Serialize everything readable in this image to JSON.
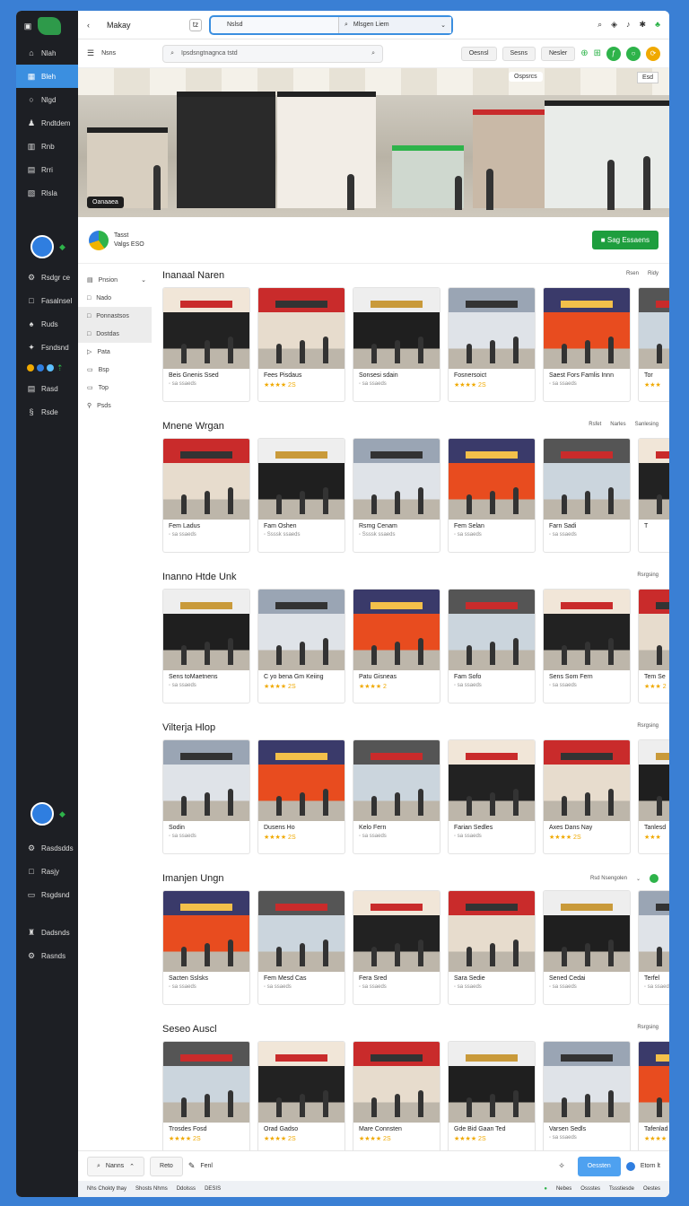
{
  "leftnav": {
    "items": [
      {
        "icon": "home-icon",
        "label": "Nlah"
      },
      {
        "icon": "grid-icon",
        "label": "Bleh"
      },
      {
        "icon": "circle-icon",
        "label": "Nlgd"
      },
      {
        "icon": "users-icon",
        "label": "Rndtdem"
      },
      {
        "icon": "chart-icon",
        "label": "Rnb"
      },
      {
        "icon": "doc-icon",
        "label": "Rrri"
      },
      {
        "icon": "file-icon",
        "label": "Rlsla"
      }
    ],
    "group2": [
      {
        "icon": "settings-icon",
        "label": "Rsdgr ce"
      },
      {
        "icon": "box-icon",
        "label": "Fasalnsel"
      },
      {
        "icon": "tag-icon",
        "label": "Ruds"
      },
      {
        "icon": "star-icon",
        "label": "Fsndsnd"
      }
    ],
    "group3": [
      {
        "icon": "doc-icon",
        "label": "Rasd"
      },
      {
        "icon": "sync-icon",
        "label": "Rsde"
      }
    ],
    "group4": [
      {
        "icon": "settings-icon",
        "label": "Rasdsdds"
      },
      {
        "icon": "box-icon",
        "label": "Rasjy"
      },
      {
        "icon": "card-icon",
        "label": "Rsgdsnd"
      }
    ],
    "group5": [
      {
        "icon": "tool-icon",
        "label": "Dadsnds"
      },
      {
        "icon": "settings-icon",
        "label": "Rasnds"
      }
    ]
  },
  "topbar": {
    "title": "Makay",
    "box_label": "tz",
    "url_left": "Nslsd",
    "url_right": "Mlsgen Liem"
  },
  "toolbar": {
    "menu_label": "Nsns",
    "search_placeholder": "Ipsdsngtnagnca tstd",
    "pills": [
      "Oesnsl",
      "Sesns",
      "Nesler"
    ]
  },
  "hero": {
    "badge_left": "Oanaaea",
    "badge_right": "Esd",
    "badge_top": "Ospsrcs"
  },
  "brand": {
    "line1": "Tasst",
    "line2": "Valgs ESO",
    "cta": "Sag Essaens"
  },
  "categories": [
    {
      "label": "Pnsion",
      "highlight": false
    },
    {
      "label": "Nado",
      "highlight": false
    },
    {
      "label": "Ponnastsos",
      "highlight": true
    },
    {
      "label": "Dostdas",
      "highlight": true
    },
    {
      "label": "Pata",
      "highlight": false
    },
    {
      "label": "Bsp",
      "highlight": false
    },
    {
      "label": "Top",
      "highlight": false
    },
    {
      "label": "Psds",
      "highlight": false
    }
  ],
  "sections": [
    {
      "title": "Inanaal Naren",
      "right": [
        "Rsen",
        "Ridy"
      ],
      "cards": [
        {
          "name": "Beis Gnenis Ssed",
          "sub": "◦ sa ssaeds",
          "stars": ""
        },
        {
          "name": "Fees Pisdaus",
          "sub": "",
          "stars": "★★★★ 2S"
        },
        {
          "name": "Sonsesi sdain",
          "sub": "◦ sa ssaeds",
          "stars": ""
        },
        {
          "name": "Fosnersoict",
          "sub": "",
          "stars": "★★★★ 2S"
        },
        {
          "name": "Saest Fors Famlis Innn",
          "sub": "◦ sa ssaeds",
          "stars": ""
        },
        {
          "name": "Tor",
          "sub": "",
          "stars": "★★★"
        }
      ]
    },
    {
      "title": "Mnene Wrgan",
      "right": [
        "Rsfet",
        "Narles",
        "Sanlesing"
      ],
      "cards": [
        {
          "name": "Fem Ladus",
          "sub": "◦ sa ssaeds",
          "stars": ""
        },
        {
          "name": "Fam Oshen",
          "sub": "◦ Ssssk ssaeds",
          "stars": ""
        },
        {
          "name": "Rsmg Cenam",
          "sub": "◦ Ssssk ssaeds",
          "stars": ""
        },
        {
          "name": "Fem Selan",
          "sub": "◦ sa ssaeds",
          "stars": ""
        },
        {
          "name": "Farn Sadi",
          "sub": "◦ sa ssaeds",
          "stars": ""
        },
        {
          "name": "T",
          "sub": "",
          "stars": ""
        }
      ]
    },
    {
      "title": "Inanno Htde Unk",
      "right": [
        "Rsrgsing"
      ],
      "cards": [
        {
          "name": "Sens toMaetnens",
          "sub": "◦ sa ssaeds",
          "stars": ""
        },
        {
          "name": "C yo bena Gm Keiing",
          "sub": "",
          "stars": "★★★★ 2S"
        },
        {
          "name": "Patu Gisneas",
          "sub": "",
          "stars": "★★★★ 2"
        },
        {
          "name": "Fam Sofo",
          "sub": "◦ sa ssaeds",
          "stars": ""
        },
        {
          "name": "Sens Som Fern",
          "sub": "◦ sa ssaeds",
          "stars": ""
        },
        {
          "name": "Tem Se",
          "sub": "",
          "stars": "★★★ 2"
        }
      ]
    },
    {
      "title": "Vilterja Hlop",
      "right": [
        "Rsrgsing"
      ],
      "cards": [
        {
          "name": "Sodin",
          "sub": "◦ sa ssaeds",
          "stars": ""
        },
        {
          "name": "Dusens Ho",
          "sub": "",
          "stars": "★★★★ 2S"
        },
        {
          "name": "Kelo Fern",
          "sub": "◦ sa ssaeds",
          "stars": ""
        },
        {
          "name": "Farian Sedles",
          "sub": "◦ sa ssaeds",
          "stars": ""
        },
        {
          "name": "Axes Dans Nay",
          "sub": "",
          "stars": "★★★★ 2S"
        },
        {
          "name": "Tanlesd",
          "sub": "",
          "stars": "★★★"
        }
      ]
    },
    {
      "title": "Imanjen Ungn",
      "right": [
        "Rsd Nsengolen"
      ],
      "cards": [
        {
          "name": "Sacten Sslsks",
          "sub": "◦ sa ssaeds",
          "stars": ""
        },
        {
          "name": "Fem Mesd Cas",
          "sub": "◦ sa ssaeds",
          "stars": ""
        },
        {
          "name": "Fera Sred",
          "sub": "◦ sa ssaeds",
          "stars": ""
        },
        {
          "name": "Sara Sedie",
          "sub": "◦ sa ssaeds",
          "stars": ""
        },
        {
          "name": "Sened Cedai",
          "sub": "◦ sa ssaeds",
          "stars": ""
        },
        {
          "name": "Terfel",
          "sub": "◦ sa ssaeds",
          "stars": ""
        }
      ]
    },
    {
      "title": "Seseo Auscl",
      "right": [
        "Rsrgsing"
      ],
      "cards": [
        {
          "name": "Trosdes Fosd",
          "sub": "",
          "stars": "★★★★ 2S"
        },
        {
          "name": "Orad Gadso",
          "sub": "",
          "stars": "★★★★ 2S"
        },
        {
          "name": "Mare Connsten",
          "sub": "",
          "stars": "★★★★ 2S"
        },
        {
          "name": "Gde Bid Gaan Ted",
          "sub": "",
          "stars": "★★★★ 2S"
        },
        {
          "name": "Varsen Sedls",
          "sub": "◦ sa ssaeds",
          "stars": ""
        },
        {
          "name": "Tafenlad",
          "sub": "",
          "stars": "★★★★"
        }
      ]
    }
  ],
  "footer": {
    "btn1": "Nanns",
    "btn2": "Reto",
    "btn3": "Fenl",
    "primary": "Oessten",
    "right": "Etorn lt"
  },
  "status": {
    "left": [
      "Nhs Chokty thay",
      "Shosts Nhms",
      "Ddolsss"
    ],
    "left_code": "DESIS",
    "right": [
      "Nebes",
      "Ossstes",
      "Tssstiesde",
      "Oestes"
    ]
  }
}
